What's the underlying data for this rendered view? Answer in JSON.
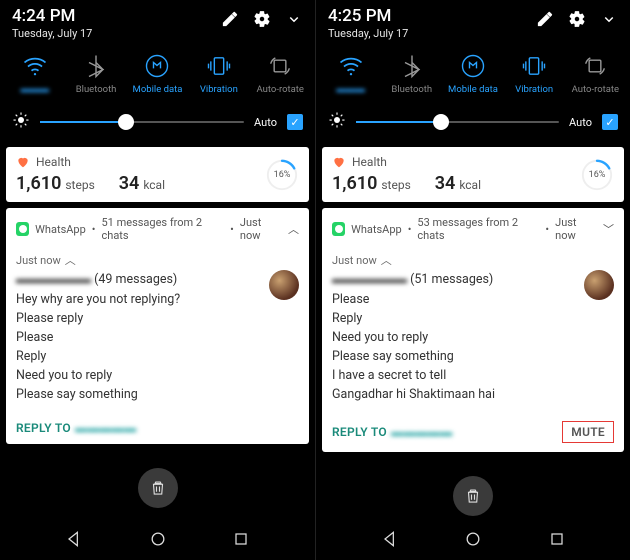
{
  "panels": [
    {
      "status": {
        "time": "4:24 PM",
        "date": "Tuesday, July 17"
      },
      "qs": {
        "wifi": {
          "label": "▬▬▬"
        },
        "bluetooth": {
          "label": "Bluetooth"
        },
        "mobile_data": {
          "label": "Mobile data"
        },
        "vibration": {
          "label": "Vibration"
        },
        "auto_rotate": {
          "label": "Auto-rotate"
        }
      },
      "brightness": {
        "auto_label": "Auto",
        "checked": true,
        "value_pct": 42
      },
      "health": {
        "app": "Health",
        "steps_num": "1,610",
        "steps_unit": "steps",
        "kcal_num": "34",
        "kcal_unit": "kcal",
        "pct": "16%"
      },
      "whatsapp": {
        "app": "WhatsApp",
        "summary": "51 messages from 2 chats",
        "ago": "Just now",
        "head_chevron": "︿",
        "body_time": "Just now",
        "sender_blur": "▬▬▬▬▬▬",
        "sender_count": "(49 messages)",
        "messages": [
          "Hey why are you not replying?",
          "Please reply",
          "Please",
          "Reply",
          "Need you to reply",
          "Please say something"
        ],
        "reply_label": "REPLY TO",
        "reply_to_blur": "▬▬▬▬▬",
        "mute_label": null
      }
    },
    {
      "status": {
        "time": "4:25 PM",
        "date": "Tuesday, July 17"
      },
      "qs": {
        "wifi": {
          "label": "▬▬▬"
        },
        "bluetooth": {
          "label": "Bluetooth"
        },
        "mobile_data": {
          "label": "Mobile data"
        },
        "vibration": {
          "label": "Vibration"
        },
        "auto_rotate": {
          "label": "Auto-rotate"
        }
      },
      "brightness": {
        "auto_label": "Auto",
        "checked": true,
        "value_pct": 42
      },
      "health": {
        "app": "Health",
        "steps_num": "1,610",
        "steps_unit": "steps",
        "kcal_num": "34",
        "kcal_unit": "kcal",
        "pct": "16%"
      },
      "whatsapp": {
        "app": "WhatsApp",
        "summary": "53 messages from 2 chats",
        "ago": "Just now",
        "head_chevron": "﹀",
        "body_time": "Just now",
        "sender_blur": "▬▬▬▬▬▬",
        "sender_count": "(51 messages)",
        "messages": [
          "Please",
          "Reply",
          "Need you to reply",
          "Please say something",
          "I have a secret to tell",
          "Gangadhar hi Shaktimaan hai"
        ],
        "reply_label": "REPLY TO",
        "reply_to_blur": "▬▬▬▬▬",
        "mute_label": "MUTE"
      }
    }
  ]
}
